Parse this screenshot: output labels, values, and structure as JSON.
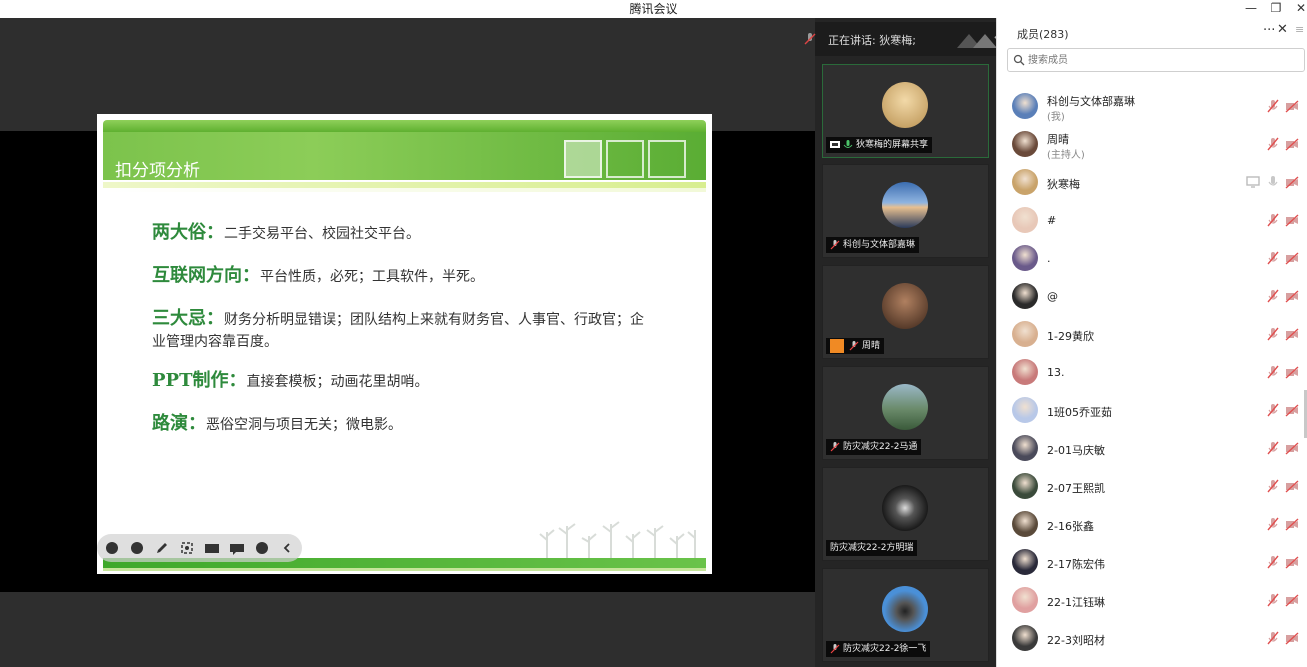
{
  "window": {
    "title": "腾讯会议",
    "minimize": "—",
    "restore": "❐",
    "close": "✕"
  },
  "slide": {
    "header_title": "扣分项分析",
    "points": [
      {
        "keyword": "两大俗：",
        "text": "二手交易平台、校园社交平台。"
      },
      {
        "keyword": "互联网方向：",
        "text": "平台性质，必死；工具软件，半死。"
      },
      {
        "keyword": "三大忌：",
        "text": "财务分析明显错误；团队结构上来就有财务官、人事官、行政官；企业管理内容靠百度。"
      },
      {
        "keyword": "PPT制作：",
        "text": "直接套模板；动画花里胡哨。"
      },
      {
        "keyword": "路演：",
        "text": "恶俗空洞与项目无关；微电影。"
      }
    ]
  },
  "speaker": {
    "label": "正在讲话: 狄寒梅;"
  },
  "video_tiles": [
    {
      "label": "狄寒梅的屏幕共享",
      "avatar_color": "#c9a36a",
      "active": true,
      "screen_share": true
    },
    {
      "label": "科创与文体部嘉琳",
      "avatar_color": "#5a7fb8",
      "active": false
    },
    {
      "label": "周晴",
      "avatar_color": "#6a4a3a",
      "active": false,
      "host_badge": true
    },
    {
      "label": "防灾减灾22-2马通",
      "avatar_color": "#4a6a4a",
      "active": false
    },
    {
      "label": "防灾减灾22-2方明瑞",
      "avatar_color": "#2a2a2a",
      "active": false,
      "no_mic": true
    },
    {
      "label": "防灾减灾22-2徐一飞",
      "avatar_color": "#3a7ac0",
      "active": false
    }
  ],
  "members": {
    "title": "成员(283)",
    "more": "···",
    "close": "✕",
    "menu": "≡",
    "search_placeholder": "搜索成员",
    "list": [
      {
        "name": "科创与文体部嘉琳",
        "sub": "(我)",
        "color": "#5a7fb8"
      },
      {
        "name": "周晴",
        "sub": "(主持人)",
        "color": "#6a4a3a"
      },
      {
        "name": "狄寒梅",
        "sub": "",
        "color": "#c9a36a",
        "speaking": true
      },
      {
        "name": "#",
        "sub": "",
        "color": "#e8c8b8"
      },
      {
        "name": ".",
        "sub": "",
        "color": "#6a5a8a"
      },
      {
        "name": "@",
        "sub": "",
        "color": "#2a2a2a"
      },
      {
        "name": "1-29黄欣",
        "sub": "",
        "color": "#d8b090"
      },
      {
        "name": "13.",
        "sub": "",
        "color": "#c87a7a"
      },
      {
        "name": "1班05乔亚茹",
        "sub": "",
        "color": "#b8c8e8"
      },
      {
        "name": "2-01马庆敏",
        "sub": "",
        "color": "#4a4a5a"
      },
      {
        "name": "2-07王熙凯",
        "sub": "",
        "color": "#3a4a3a"
      },
      {
        "name": "2-16张鑫",
        "sub": "",
        "color": "#5a4a3a"
      },
      {
        "name": "2-17陈宏伟",
        "sub": "",
        "color": "#2a2a3a"
      },
      {
        "name": "22-1江钰琳",
        "sub": "",
        "color": "#e0a0a0"
      },
      {
        "name": "22-3刘昭材",
        "sub": "",
        "color": "#3a3a3a"
      }
    ]
  }
}
